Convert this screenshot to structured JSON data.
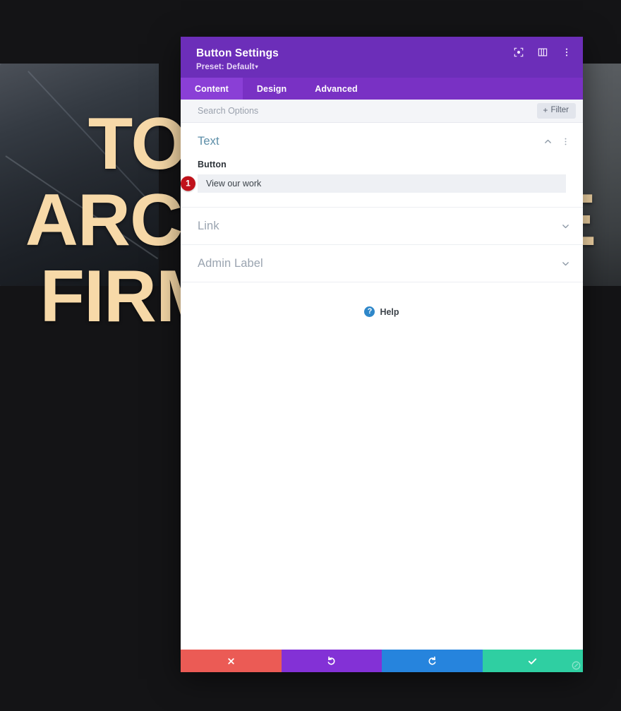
{
  "background": {
    "headline": "TOP–NOTCH\nARCHITECTURE\nFIRM BASED IN\nNY",
    "headline_color": "#f7d9a8",
    "page_bg_color": "#141416"
  },
  "modal": {
    "title": "Button Settings",
    "preset_label": "Preset: Default",
    "preset_caret": "▾",
    "header_color": "#6c2eb9",
    "header_icons": [
      {
        "name": "fullscreen-icon",
        "label": "Fullscreen"
      },
      {
        "name": "layout-panel-icon",
        "label": "Change Panel Position"
      },
      {
        "name": "more-options-icon",
        "label": "More Options"
      }
    ],
    "tabs": [
      {
        "label": "Content",
        "active": true
      },
      {
        "label": "Design",
        "active": false
      },
      {
        "label": "Advanced",
        "active": false
      }
    ],
    "search": {
      "placeholder": "Search Options",
      "value": ""
    },
    "filter": {
      "label": "Filter",
      "plus": "+"
    },
    "sections": [
      {
        "title": "Text",
        "open": true,
        "chevron": "up",
        "field_label": "Button",
        "field_value": "View our work",
        "badge": "1",
        "badge_color": "#c0121b"
      },
      {
        "title": "Link",
        "open": false,
        "chevron": "down"
      },
      {
        "title": "Admin Label",
        "open": false,
        "chevron": "down"
      }
    ],
    "help": {
      "icon_glyph": "?",
      "label": "Help"
    },
    "footer_buttons": [
      {
        "name": "cancel-button",
        "icon": "close-icon",
        "color": "#eb5b55"
      },
      {
        "name": "undo-button",
        "icon": "undo-icon",
        "color": "#8331d6"
      },
      {
        "name": "redo-button",
        "icon": "redo-icon",
        "color": "#2684dd"
      },
      {
        "name": "save-button",
        "icon": "check-icon",
        "color": "#2fcfa2"
      }
    ]
  }
}
